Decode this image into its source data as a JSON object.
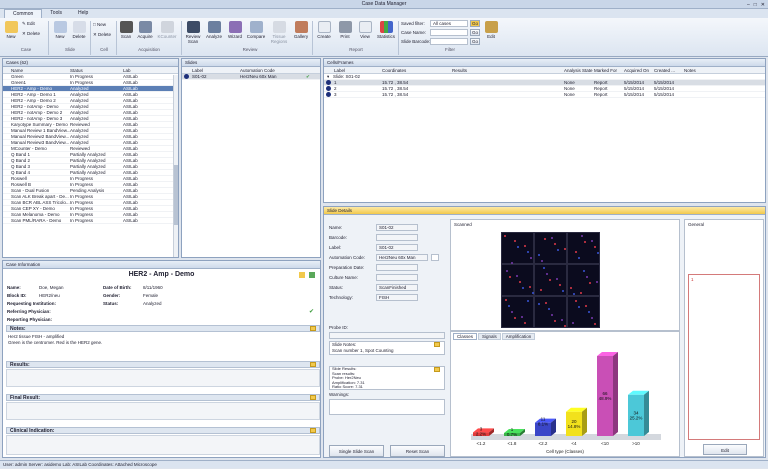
{
  "window": {
    "title": "Case Data Manager"
  },
  "menu": {
    "items": [
      "Common",
      "Tools",
      "Help"
    ]
  },
  "ribbon": {
    "buttons": {
      "new_case": "New",
      "edit_case": "Edit",
      "delete_case": "Delete",
      "new_slide": "New",
      "delete_slide": "Delete",
      "new_cell": "New",
      "delete_cell": "Delete",
      "scan": "Scan",
      "acquire": "Acquire",
      "kcounter": "KCounter",
      "review_scan": "Review Scan",
      "analyze": "Analyze",
      "wizard": "Wizard",
      "compare": "Compare",
      "tissue_regions": "Tissue Regions",
      "gallery": "Gallery",
      "create": "Create",
      "print": "Print",
      "view": "View",
      "statistics": "Statistics",
      "go1": "Go",
      "go2": "Go",
      "go3": "Go",
      "filter_edit": "Edit"
    },
    "groups": {
      "case": "Case",
      "slide": "Slide",
      "cell": "Cell",
      "acquisition": "Acquisition",
      "review": "Review",
      "report": "Report",
      "filter": "Filter"
    },
    "filter": {
      "saved_filter_label": "Saved filter:",
      "saved_filter_value": "All cases",
      "case_name_label": "Case Name:",
      "slide_barcode_label": "Slide Barcode:"
    }
  },
  "cases": {
    "title": "Cases (62)",
    "columns": [
      "Name",
      "Status",
      "Lab"
    ],
    "rows": [
      {
        "name": "Green",
        "status": "In Progress",
        "lab": "ASILab"
      },
      {
        "name": "Green1",
        "status": "In Progress",
        "lab": "ASILab"
      },
      {
        "name": "HER2 - Amp - Demo",
        "status": "Analyzed",
        "lab": "ASILab"
      },
      {
        "name": "HER2 - Amp - Demo 1",
        "status": "Analyzed",
        "lab": "ASILab"
      },
      {
        "name": "HER2 - Amp - Demo 2",
        "status": "Analyzed",
        "lab": "ASILab"
      },
      {
        "name": "HER2 - notAmp - Demo",
        "status": "Analyzed",
        "lab": "ASILab"
      },
      {
        "name": "HER2 - notAmp - Demo 2",
        "status": "Analyzed",
        "lab": "ASILab"
      },
      {
        "name": "HER2 - notAmp - Demo 3",
        "status": "Analyzed",
        "lab": "ASILab"
      },
      {
        "name": "Karyotype Summary - Demo",
        "status": "Reviewed",
        "lab": "ASILab"
      },
      {
        "name": "Manual Review 1 BandView...",
        "status": "Analyzed",
        "lab": "ASILab"
      },
      {
        "name": "Manual Review2 BandView...",
        "status": "Analyzed",
        "lab": "ASILab"
      },
      {
        "name": "Manual Review3 BandView...",
        "status": "Analyzed",
        "lab": "ASILab"
      },
      {
        "name": "MCounter - Demo",
        "status": "Reviewed",
        "lab": "ASILab"
      },
      {
        "name": "Q Band 1",
        "status": "Partially Analyzed",
        "lab": "ASILab"
      },
      {
        "name": "Q Band 2",
        "status": "Partially Analyzed",
        "lab": "ASILab"
      },
      {
        "name": "Q Band 3",
        "status": "Partially Analyzed",
        "lab": "ASILab"
      },
      {
        "name": "Q Band 4",
        "status": "Partially Analyzed",
        "lab": "ASILab"
      },
      {
        "name": "Roswell",
        "status": "In Progress",
        "lab": "ASILab"
      },
      {
        "name": "Roswell B",
        "status": "In Progress",
        "lab": "ASILab"
      },
      {
        "name": "Scan - Dual Fusion",
        "status": "Pending Analysis",
        "lab": "ASILab"
      },
      {
        "name": "Scan ALK Break apart - De...",
        "status": "In Progress",
        "lab": "ASILab"
      },
      {
        "name": "Scan BCR ABL ASS Tricolo...",
        "status": "In Progress",
        "lab": "ASILab"
      },
      {
        "name": "Scan CEP XY - Demo",
        "status": "In Progress",
        "lab": "ASILab"
      },
      {
        "name": "Scan Melanoma - Demo",
        "status": "In Progress",
        "lab": "ASILab"
      },
      {
        "name": "Scan PML/RARA - Demo",
        "status": "In Progress",
        "lab": "ASILab"
      }
    ]
  },
  "slides": {
    "title": "Slides",
    "columns": [
      "Label",
      "Automation Code"
    ],
    "rows": [
      {
        "label": "S01-02",
        "code": "Her2Neu 60x Man"
      }
    ]
  },
  "cells": {
    "title": "Cells/Frames",
    "columns": [
      "Label",
      "Coordinates",
      "Results",
      "Analysis State",
      "Marked For",
      "Acquired On",
      "Created ...",
      "Notes"
    ],
    "group": "Slide: S01-02",
    "rows": [
      {
        "label": "1",
        "coords": "15.72  ,  38.54",
        "state": "None",
        "marked": "Report",
        "acquired": "5/15/2014",
        "created": "5/15/2014"
      },
      {
        "label": "2",
        "coords": "15.72  ,  38.54",
        "state": "None",
        "marked": "Report",
        "acquired": "5/15/2014",
        "created": "5/15/2014"
      },
      {
        "label": "3",
        "coords": "15.72  ,  38.54",
        "state": "None",
        "marked": "Report",
        "acquired": "5/15/2014",
        "created": "5/15/2014"
      }
    ]
  },
  "case_info": {
    "title": "Case Information",
    "case_name": "HER2 - Amp - Demo",
    "name_label": "Name:",
    "name_value": "Doe, Megan",
    "dob_label": "Date of Birth:",
    "dob_value": "8/11/1960",
    "block_label": "Block ID:",
    "block_value": "HER2/neu",
    "gender_label": "Gender:",
    "gender_value": "Female",
    "req_label": "Requesting Institution:",
    "status_label": "Status:",
    "status_value": "Analyzed",
    "ref_label": "Referring Physician:",
    "rep_label": "Reporting Physician:",
    "notes_label": "Notes:",
    "notes_line1": "Her2 tissue FISH - amplified",
    "notes_line2": "Green is the centromer. Red is the HER2 gene.",
    "results_label": "Results:",
    "final_label": "Final Result:",
    "clinical_label": "Clinical Indication:"
  },
  "slide_details": {
    "title": "Slide Details",
    "name_label": "Name:",
    "name_value": "S01-02",
    "barcode_label": "Barcode:",
    "label_label": "Label:",
    "label_value": "S01-02",
    "code_label": "Automation Code:",
    "code_value": "Her2Neu 60x Man",
    "prep_label": "Preparation Date:",
    "culture_label": "Culture Name:",
    "status_label": "Status:",
    "status_value": "ScanFinished",
    "tech_label": "Technology:",
    "tech_value": "FISH",
    "probe_label": "Probe ID:",
    "notes_label": "Slide Notes:",
    "notes_value": "Scan number 1, Spot Counting",
    "results_label": "Slide Results:",
    "results_lines": [
      "Scan results:",
      "Probe: Her2Neu",
      "Amplification: 7.31",
      "Ratio Score: 7.31"
    ],
    "warnings_label": "Warnings:",
    "single_scan": "Single Slide Scan",
    "reset_scan": "Reset Scan"
  },
  "scanned": {
    "title": "Scanned"
  },
  "general": {
    "title": "General",
    "text": "1",
    "edit": "Edit"
  },
  "tabs": [
    "Classes",
    "Signals",
    "Amplification"
  ],
  "chart_data": {
    "type": "bar",
    "xlabel": "Cell type (Classes)",
    "categories": [
      "<1.2",
      "<1.8",
      "<2.2",
      "<4",
      "<10",
      ">10"
    ],
    "values": [
      3,
      1,
      11,
      20,
      66,
      34
    ],
    "labels": [
      "3\n2.2%",
      "1\n0.7%",
      "11\n8.1%",
      "20\n14.8%",
      "66\n48.9%",
      "34\n25.2%"
    ],
    "colors": [
      "#e23b3b",
      "#3bb44a",
      "#3b46c8",
      "#f2e11c",
      "#c94fb6",
      "#4cc8d8"
    ]
  },
  "status": {
    "text": "User: admin   Server: asidemo   Lab: ASILab   Coordinates: Attached Microscope"
  }
}
